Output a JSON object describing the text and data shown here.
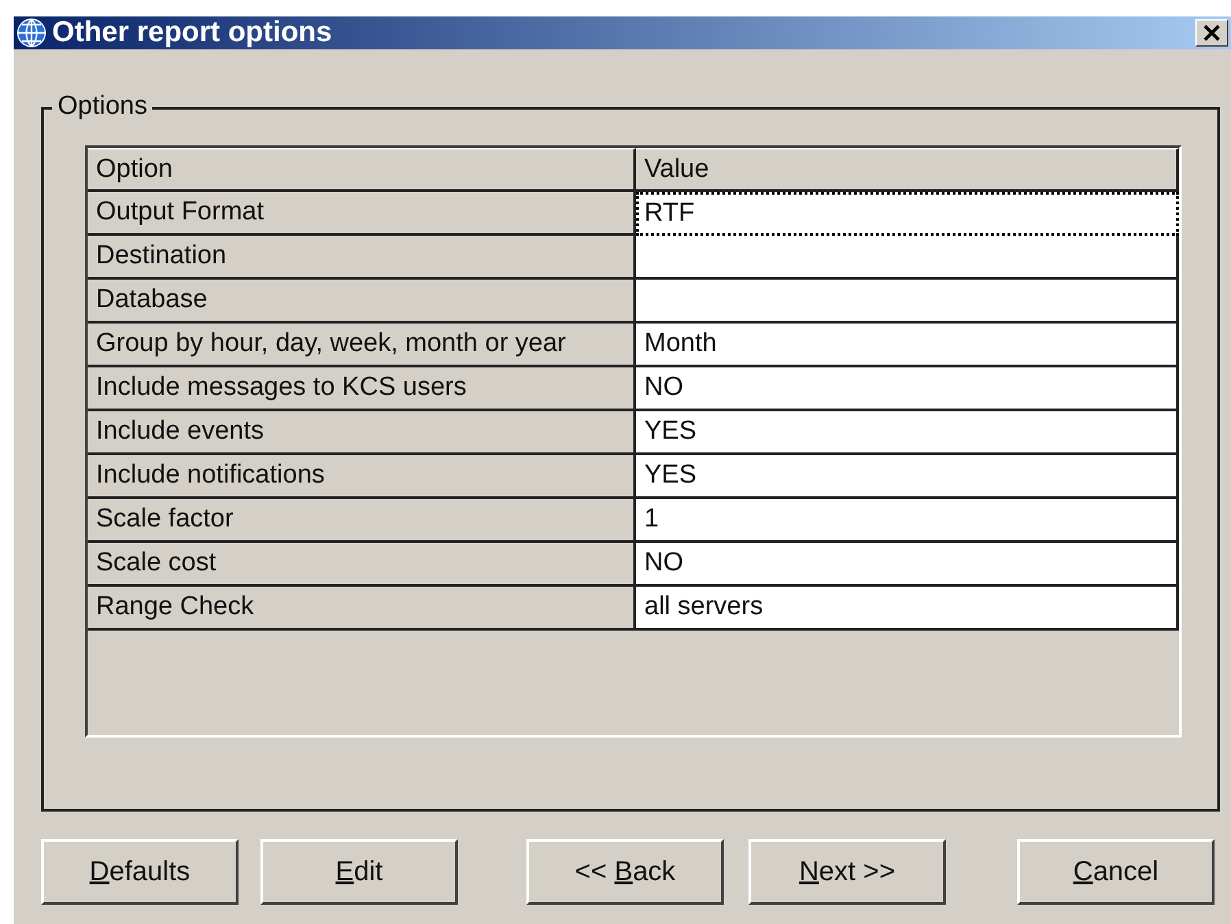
{
  "window": {
    "title": "Other report options"
  },
  "group": {
    "label": "Options"
  },
  "table": {
    "columns": [
      "Option",
      "Value"
    ],
    "rows": [
      {
        "option": "Output Format",
        "value": "RTF",
        "selected": true
      },
      {
        "option": "Destination",
        "value": "",
        "selected": false
      },
      {
        "option": "Database",
        "value": "",
        "selected": false
      },
      {
        "option": "Group by hour, day, week, month or year",
        "value": "Month",
        "selected": false
      },
      {
        "option": "Include messages to KCS users",
        "value": "NO",
        "selected": false
      },
      {
        "option": "Include events",
        "value": "YES",
        "selected": false
      },
      {
        "option": "Include notifications",
        "value": "YES",
        "selected": false
      },
      {
        "option": "Scale factor",
        "value": "1",
        "selected": false
      },
      {
        "option": "Scale cost",
        "value": "NO",
        "selected": false
      },
      {
        "option": "Range Check",
        "value": "all servers",
        "selected": false
      }
    ]
  },
  "buttons": [
    {
      "access_key": "D",
      "after": "efaults"
    },
    {
      "access_key": "E",
      "after": "dit"
    },
    {
      "before": "<< ",
      "access_key": "B",
      "after": "ack"
    },
    {
      "access_key": "N",
      "after": "ext >>"
    },
    {
      "access_key": "C",
      "after": "ancel"
    }
  ]
}
